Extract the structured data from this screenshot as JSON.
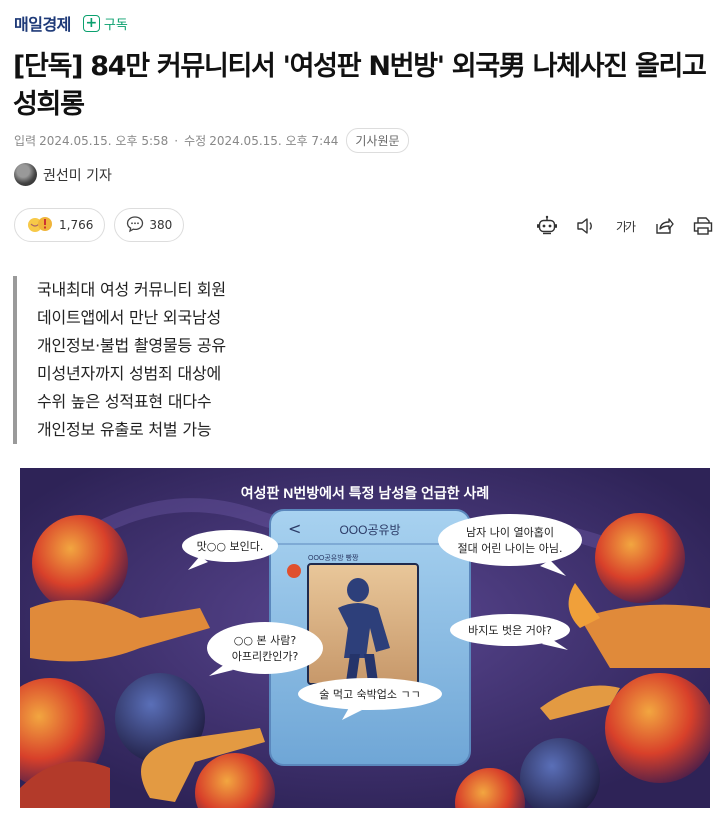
{
  "press": {
    "name": "매일경제",
    "subscribe_label": "구독"
  },
  "article": {
    "title": "[단독] 84만 커뮤니티서 '여성판 N번방' 외국男 나체사진 올리고 성희롱",
    "input_label": "입력",
    "input_time": "2024.05.15. 오후 5:58",
    "modified_label": "수정",
    "modified_time": "2024.05.15. 오후 7:44",
    "origin_button": "기사원문"
  },
  "reporter": {
    "name": "권선미 기자"
  },
  "reactions": {
    "like_count": "1,766",
    "comment_count": "380"
  },
  "toolbar": {
    "icons": [
      "robot-summary-icon",
      "speaker-icon",
      "font-size-icon",
      "share-icon",
      "print-icon"
    ],
    "font_size_label": "가가"
  },
  "summary": [
    "국내최대 여성 커뮤니티 회원",
    "데이트앱에서 만난 외국남성",
    "개인정보·불법 촬영물등 공유",
    "미성년자까지 성범죄 대상에",
    "수위 높은 성적표현 대다수",
    "개인정보 유출로 처벌 가능"
  ],
  "illustration": {
    "caption": "여성판 N번방에서 특정 남성을 언급한 사례",
    "chat_title": "OOO공유방",
    "chat_subtitle": "OOO공유방 빵짱",
    "bubble_1": "맛○○ 보인다.",
    "bubble_2_line1": "남자 나이 열아홉이",
    "bubble_2_line2": "절대 어린 나이는 아님.",
    "bubble_3": "바지도 벗은 거야?",
    "bubble_4_line1": "○○ 본 사람?",
    "bubble_4_line2": "아프리칸인가?",
    "bubble_5": "술 먹고 숙박업소 ㄱㄱ",
    "colors": {
      "background": "#3f2f6d",
      "phone": "#8fbfe6",
      "accent_red": "#d8402a",
      "accent_orange": "#f0a03a"
    }
  }
}
